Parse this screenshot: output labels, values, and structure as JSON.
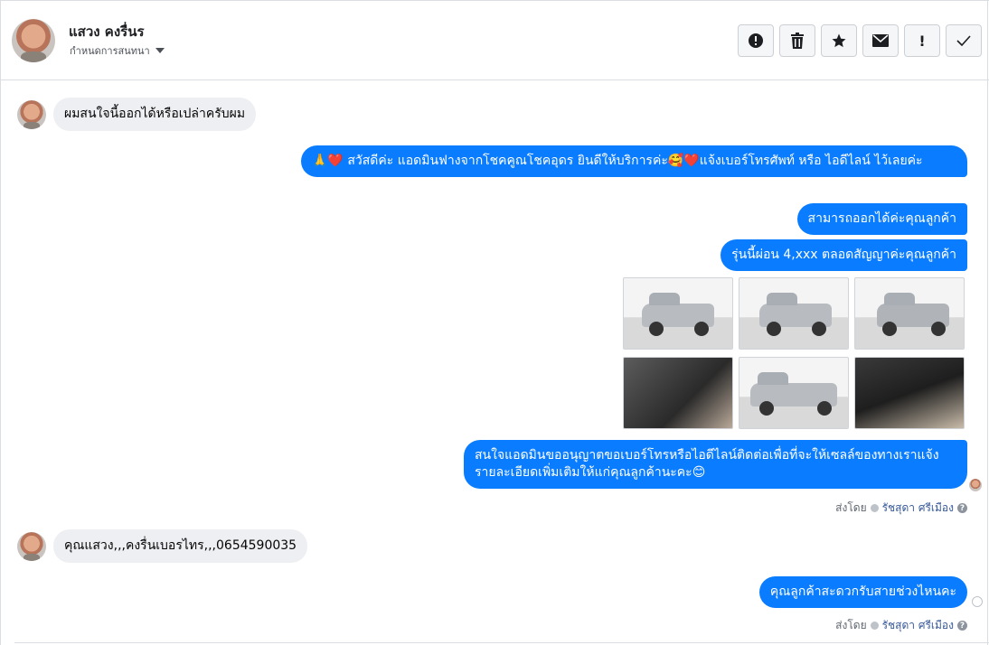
{
  "header": {
    "contact_name": "แสวง คงรื่นร",
    "assign_label": "กำหนดการสนทนา",
    "actions": [
      {
        "name": "spam-icon",
        "label": "!"
      },
      {
        "name": "trash-icon",
        "label": ""
      },
      {
        "name": "star-icon",
        "label": ""
      },
      {
        "name": "mail-icon",
        "label": ""
      },
      {
        "name": "important-icon",
        "label": "!"
      },
      {
        "name": "check-icon",
        "label": ""
      }
    ]
  },
  "messages": {
    "in1": "ผมสนใจนี้ออกได้หรือเปล่าครับผม",
    "out1": "🙏❤️ สวัสดีค่ะ แอดมินฟางจากโชคคูณโชคอุดร ยินดีให้บริการค่ะ🥰❤️แจ้งเบอร์โทรศัพท์ หรือ ไอดีไลน์  ไว้เลยค่ะ",
    "out2": "สามารถออกได้ค่ะคุณลูกค้า",
    "out3": "รุ่นนี้ผ่อน 4,xxx ตลอดสัญญาค่ะคุณลูกค้า",
    "out4": "สนใจแอดมินขออนุญาตขอเบอร์โทรหรือไอดีไลน์ติดต่อเพื่อที่จะให้เซลล์ของทางเราแจ้งรายละเอียดเพิ่มเติมให้แก่คุณลูกค้านะคะ😊",
    "in2": "คุณแสวง,,,คงรื่นเบอรไทร,,,0654590035",
    "out5": "คุณลูกค้าสะดวกรับสายช่วงไหนคะ"
  },
  "meta": {
    "sent_by": "ส่งโดย",
    "agent": "รัชสุดา ศรีเมือง"
  },
  "gallery": [
    "exterior-front-left",
    "exterior-front",
    "exterior-rear",
    "interior-dashboard",
    "exterior-side",
    "interior-gearshift"
  ]
}
